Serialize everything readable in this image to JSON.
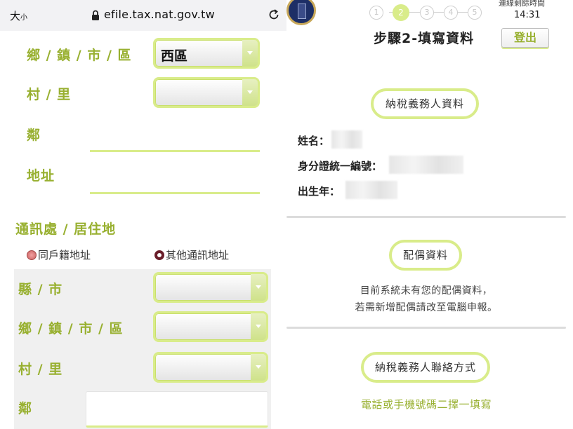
{
  "browser": {
    "text_size": "大",
    "text_size_small": "小",
    "url": "efile.tax.nat.gov.tw"
  },
  "registered_address": {
    "township_label": "鄉 / 鎮 / 市 / 區",
    "township_value": "西區",
    "village_label": "村 / 里",
    "village_value": "",
    "neighborhood_label": "鄰",
    "address_label": "地址"
  },
  "mailing_address": {
    "title": "通訊處 / 居住地",
    "radio_same": "同戶籍地址",
    "radio_other": "其他通訊地址",
    "county_label": "縣 / 市",
    "township_label": "鄉 / 鎮 / 市 / 區",
    "village_label": "村 / 里",
    "neighborhood_label": "鄰"
  },
  "header": {
    "steps": [
      "1",
      "2",
      "3",
      "4",
      "5"
    ],
    "active_step": 2,
    "timer_label": "連線剩餘時間",
    "timer_value": "14:31",
    "title": "步驟2-填寫資料",
    "logout_label": "登出"
  },
  "taxpayer": {
    "title": "納稅義務人資料",
    "name_label": "姓名：",
    "id_label": "身分證統一編號：",
    "birth_label": "出生年："
  },
  "spouse": {
    "title": "配偶資料",
    "message_line1": "目前系統未有您的配偶資料，",
    "message_line2": "若需新增配偶請改至電腦申報。"
  },
  "contact": {
    "title": "納稅義務人聯絡方式",
    "note": "電話或手機號碼二擇一填寫"
  },
  "colors": {
    "accent_green": "#98b030",
    "light_green": "#d9ec8a"
  }
}
